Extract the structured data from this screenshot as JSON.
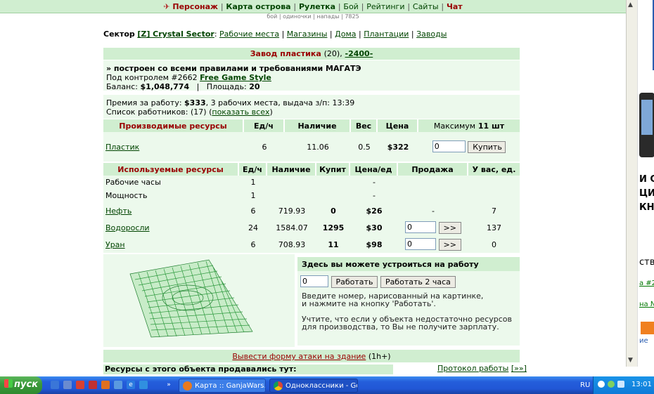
{
  "nav": {
    "items": [
      "Персонаж",
      "Карта острова",
      "Рулетка",
      "Бой",
      "Рейтинги",
      "Сайты",
      "Чат"
    ],
    "sub": [
      "бой",
      "одиночки",
      "напады",
      "7825"
    ]
  },
  "sector": {
    "label": "Сектор",
    "name": "[Z] Crystal Sector",
    "links": [
      "Рабочие места",
      "Магазины",
      "Дома",
      "Плантации",
      "Заводы"
    ]
  },
  "factory": {
    "title": "Завод пластика",
    "count": "(20),",
    "id_link": "-2400-",
    "desc": "» построен со всеми правилами и требованиями МАГАТЭ",
    "control_prefix": "Под контролем #2662",
    "owner": "Free Game Style",
    "balance_label": "Баланс:",
    "balance": "$1,048,774",
    "area_label": "Площадь:",
    "area": "20",
    "premium_label": "Премия за работу:",
    "premium": "$333",
    "premium_rest": ", 3 рабочих места, выдача з/п: 13:39",
    "workers_label": "Список работников: (17)",
    "workers_link": "показать всех"
  },
  "produced": {
    "headers": [
      "Производимые ресурсы",
      "Ед/ч",
      "Наличие",
      "Вес",
      "Цена",
      "Максимум"
    ],
    "max_value": "11 шт",
    "row": {
      "name": "Пластик",
      "rate": "6",
      "stock": "11.06",
      "weight": "0.5",
      "price": "$322",
      "qty": "0",
      "buy": "Купить"
    }
  },
  "used": {
    "headers": [
      "Используемые ресурсы",
      "Ед/ч",
      "Наличие",
      "Купит",
      "Цена/ед",
      "Продажа",
      "У вас, ед."
    ],
    "rows": [
      {
        "name": "Рабочие часы",
        "rate": "1",
        "stock": "",
        "buy": "",
        "price": "-",
        "sale": "",
        "have": ""
      },
      {
        "name": "Мощность",
        "rate": "1",
        "stock": "",
        "buy": "",
        "price": "-",
        "sale": "",
        "have": ""
      },
      {
        "name": "Нефть",
        "rate": "6",
        "stock": "719.93",
        "buy": "0",
        "price": "$26",
        "sale": "-",
        "have": "7"
      },
      {
        "name": "Водоросли",
        "rate": "24",
        "stock": "1584.07",
        "buy": "1295",
        "price": "$30",
        "sale": "0",
        "have": "137"
      },
      {
        "name": "Уран",
        "rate": "6",
        "stock": "708.93",
        "buy": "11",
        "price": "$98",
        "sale": "0",
        "have": "0"
      }
    ],
    "sell_btn": ">>"
  },
  "work": {
    "title": "Здесь вы можете устроиться на работу",
    "input_value": "0",
    "work_btn": "Работать",
    "work2_btn": "Работать 2 часа",
    "note1a": "Введите номер, нарисованный на картинке,",
    "note1b": "и нажмите на кнопку 'Работать'.",
    "note2a": "Учтите, что если у объекта недостаточно ресурсов",
    "note2b": "для производства, то Вы не получите зарплату."
  },
  "attack": {
    "link": "Вывести форму атаки на здание",
    "time": "(1h+)"
  },
  "sold": {
    "title": "Ресурсы с этого объекта продавались тут:"
  },
  "protocol": {
    "link": "Протокол работы",
    "more": "[»»]"
  },
  "taskbar": {
    "start": "пуск",
    "task1": "Карта :: GanjaWars....",
    "task2": "Одноклассники - Go...",
    "lang": "RU",
    "time": "13:01"
  },
  "side": {
    "t1": "И СЕ",
    "t2": "ЦИС",
    "t3": "КНО",
    "t4": "ства",
    "t5": "а #2",
    "t6": "на №",
    "t7": "ие",
    "colors": {
      "accent": "#2a5db0",
      "orange": "#f08020"
    }
  },
  "colors": {
    "header_bg": "#d0eed0",
    "panel_bg": "#ecf9ec",
    "title_red": "#990000",
    "link_green": "#004400"
  }
}
